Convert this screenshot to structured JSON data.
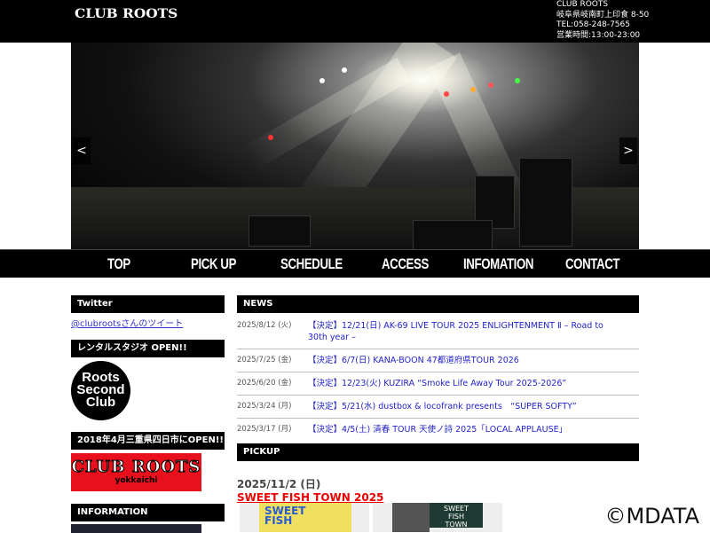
{
  "header": {
    "logo": "CLUB ROOTS",
    "info": [
      "CLUB ROOTS",
      "岐阜県岐南町上印食 8-50",
      "TEL:058-248-7565",
      "営業時間:13:00-23:00"
    ]
  },
  "slider": {
    "prev": "<",
    "next": ">"
  },
  "nav": [
    "TOP",
    "PICK UP",
    "SCHEDULE",
    "ACCESS",
    "INFOMATION",
    "CONTACT"
  ],
  "sidebar": {
    "twitter_heading": "Twitter",
    "twitter_link": "@clubrootsさんのツイート",
    "rental_heading": "レンタルスタジオ OPEN!!",
    "rental_logo": "Roots Second Club",
    "yokkaichi_heading": "2018年4月三重県四日市にOPEN!!",
    "yokkaichi_logo": "CLUB ROOTS",
    "yokkaichi_sub": "yokkaichi",
    "info_heading": "INFORMATION"
  },
  "news": {
    "heading": "NEWS",
    "items": [
      {
        "date": "2025/8/12 (火)",
        "title": "【決定】12/21(日) AK-69 LIVE TOUR 2025 ENLIGHTENMENT Ⅱ – Road to 30th year –"
      },
      {
        "date": "2025/7/25 (金)",
        "title": "【決定】6/7(日) KANA-BOON 47都道府県TOUR 2026"
      },
      {
        "date": "2025/6/20 (金)",
        "title": "【決定】12/23(火) KUZIRA “Smoke Life Away Tour 2025-2026”"
      },
      {
        "date": "2025/3/24 (月)",
        "title": "【決定】5/21(水) dustbox & locofrank presents　“SUPER SOFTY”"
      },
      {
        "date": "2025/3/17 (月)",
        "title": "【決定】4/5(土) 清春 TOUR 天使ノ詩 2025「LOCAL APPLAUSE」"
      }
    ]
  },
  "pickup": {
    "heading": "PICKUP",
    "date": "2025/11/2 (日)",
    "title": "SWEET FISH TOWN 2025",
    "poster_text": "SWEET FISH TOWN"
  },
  "watermark": "©MDATA"
}
